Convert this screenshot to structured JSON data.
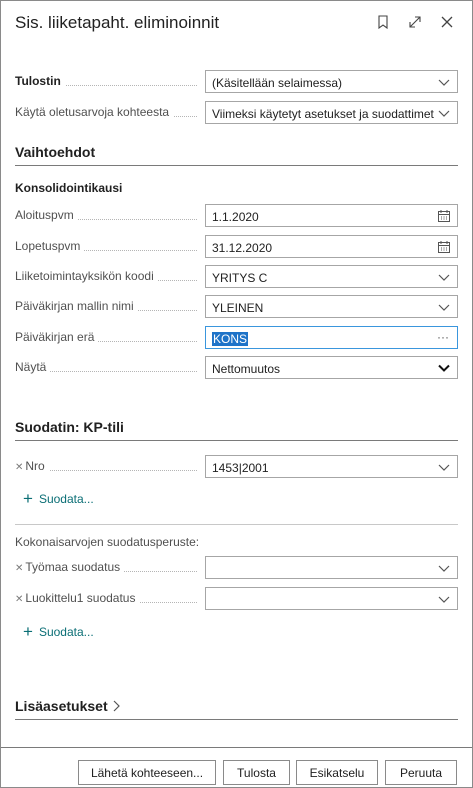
{
  "dialog": {
    "title": "Sis. liiketapaht. eliminoinnit",
    "bookmark_icon": "bookmark-icon",
    "expand_icon": "expand-icon",
    "close_icon": "close-icon"
  },
  "printer": {
    "label": "Tulostin",
    "value": "(Käsitellään selaimessa)"
  },
  "defaults": {
    "label": "Käytä oletusarvoja kohteesta",
    "value": "Viimeksi käytetyt asetukset ja suodattimet"
  },
  "options": {
    "heading": "Vaihtoehdot",
    "subheading": "Konsolidointikausi",
    "start_date": {
      "label": "Aloituspvm",
      "value": "1.1.2020"
    },
    "end_date": {
      "label": "Lopetuspvm",
      "value": "31.12.2020"
    },
    "business_unit": {
      "label": "Liiketoimintayksikön koodi",
      "value": "YRITYS C"
    },
    "journal_template": {
      "label": "Päiväkirjan mallin nimi",
      "value": "YLEINEN"
    },
    "journal_batch": {
      "label": "Päiväkirjan erä",
      "value": "KONS",
      "more": "···"
    },
    "show": {
      "label": "Näytä",
      "value": "Nettomuutos"
    }
  },
  "filter": {
    "heading": "Suodatin: KP-tili",
    "nro": {
      "label": "Nro",
      "value": "1453|2001"
    },
    "add_label": "Suodata...",
    "totals_heading": "Kokonaisarvojen suodatusperuste:",
    "job_filter": {
      "label": "Työmaa suodatus",
      "value": ""
    },
    "class1_filter": {
      "label": "Luokittelu1 suodatus",
      "value": ""
    },
    "add_label2": "Suodata..."
  },
  "advanced": {
    "label": "Lisäasetukset"
  },
  "buttons": {
    "send": "Lähetä kohteeseen...",
    "print": "Tulosta",
    "preview": "Esikatselu",
    "cancel": "Peruuta"
  }
}
